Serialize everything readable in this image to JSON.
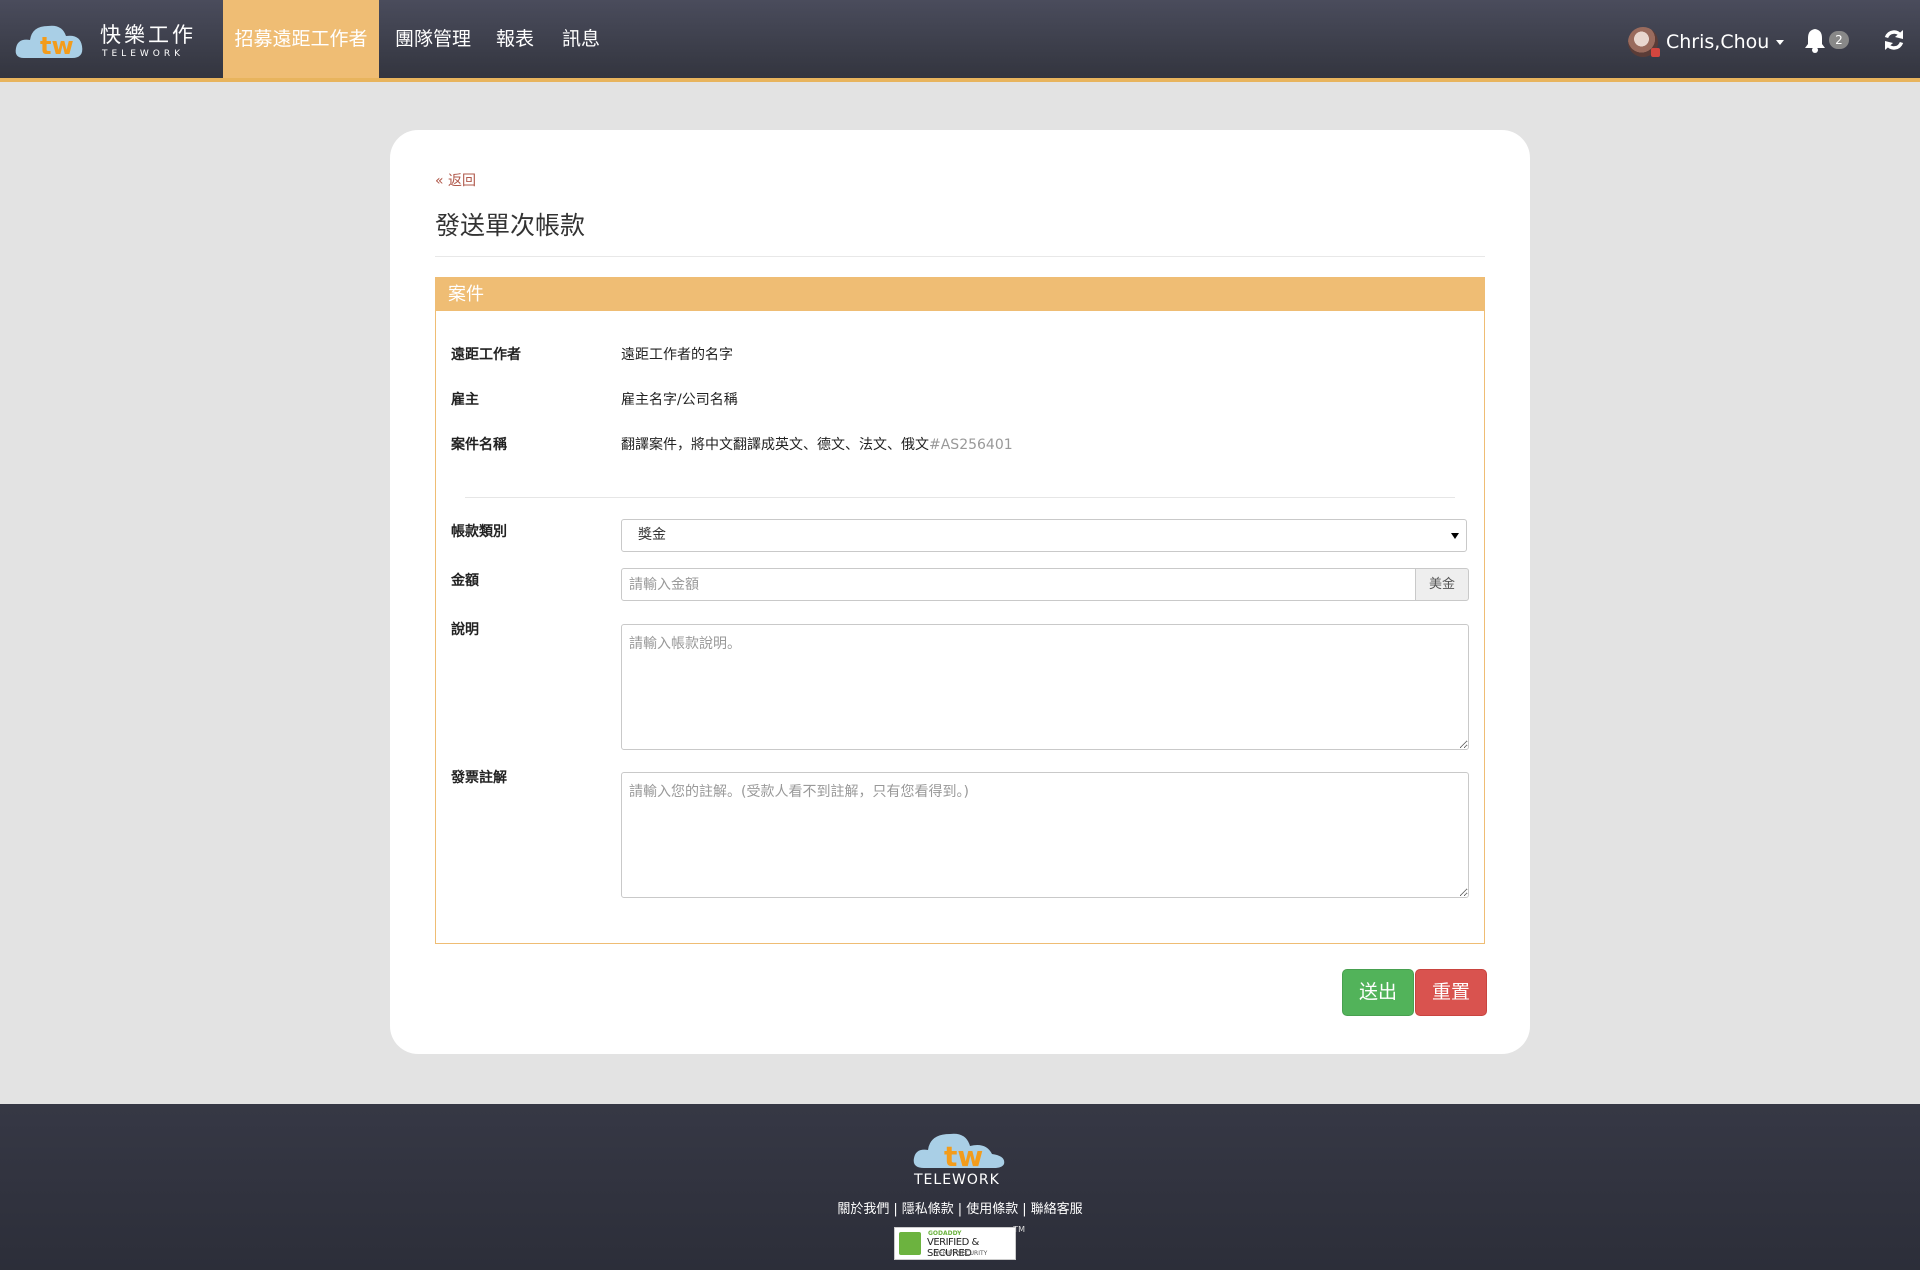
{
  "brand": {
    "name_cn": "快樂工作",
    "name_en": "TELEWORK",
    "logo_mark": "tw"
  },
  "nav": {
    "items": [
      {
        "label": "招募遠距工作者",
        "active": true
      },
      {
        "label": "團隊管理",
        "active": false
      },
      {
        "label": "報表",
        "active": false
      },
      {
        "label": "訊息",
        "active": false
      }
    ]
  },
  "user": {
    "name": "Chris,Chou",
    "notifications": "2"
  },
  "page": {
    "back_label": "« 返回",
    "title": "發送單次帳款"
  },
  "panel": {
    "title": "案件",
    "info": [
      {
        "label": "遠距工作者",
        "value": "遠距工作者的名字"
      },
      {
        "label": "雇主",
        "value": "雇主名字/公司名稱"
      },
      {
        "label": "案件名稱",
        "value": "翻譯案件，將中文翻譯成英文、德文、法文、俄文",
        "ref": "#AS256401"
      }
    ],
    "form": {
      "type_label": "帳款類別",
      "type_value": "獎金",
      "amount_label": "金額",
      "amount_placeholder": "請輸入金額",
      "currency": "美金",
      "desc_label": "說明",
      "desc_placeholder": "請輸入帳款說明。",
      "note_label": "發票註解",
      "note_placeholder": "請輸入您的註解。(受款人看不到註解，只有您看得到。)"
    }
  },
  "actions": {
    "submit": "送出",
    "reset": "重置"
  },
  "footer": {
    "logo_text": "TELEWORK",
    "links": [
      "關於我們",
      "隱私條款",
      "使用條款",
      "聯絡客服"
    ],
    "separator": "|",
    "seal": {
      "brand": "GODADDY",
      "text": "VERIFIED & SECURED",
      "sub": "VERIFY SECURITY",
      "tm": "TM"
    }
  },
  "colors": {
    "nav_active": "#efbd74",
    "accent_border": "#e8b45d",
    "submit": "#52b35a",
    "reset": "#d9534f",
    "nav_bg": "#3c3e4b",
    "page_bg": "#e3e3e3"
  }
}
